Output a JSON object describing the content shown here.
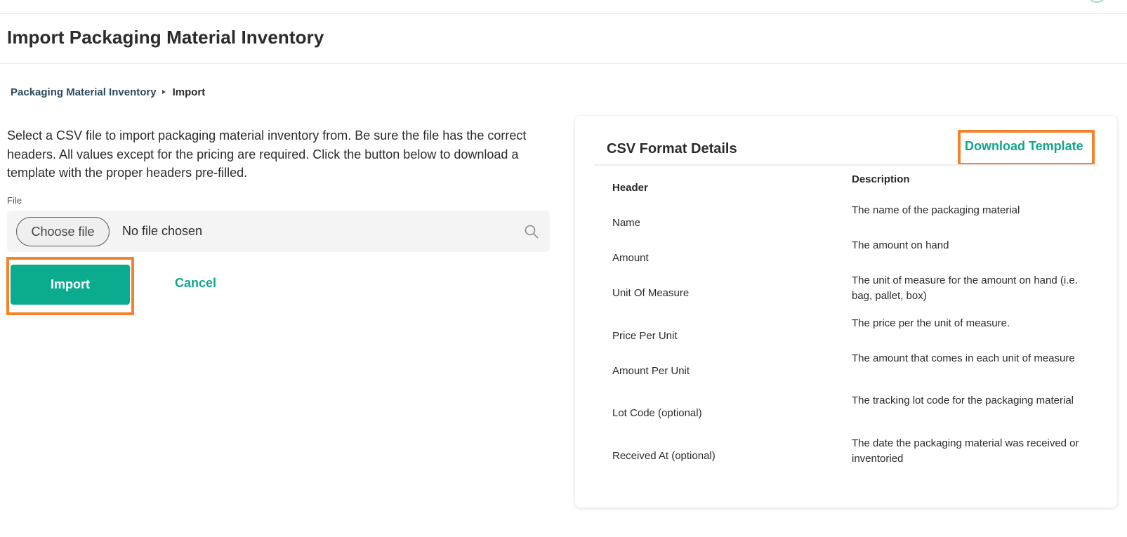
{
  "page": {
    "title": "Import Packaging Material Inventory"
  },
  "breadcrumb": {
    "parent": "Packaging Material Inventory",
    "current": "Import"
  },
  "form": {
    "intro": "Select a CSV file to import packaging material inventory from. Be sure the file has the correct headers. All values except for the pricing are required. Click the button below to download a template with the proper headers pre-filled.",
    "file_label": "File",
    "choose_file_label": "Choose file",
    "no_file_text": "No file chosen",
    "import_label": "Import",
    "cancel_label": "Cancel"
  },
  "csv_card": {
    "title": "CSV Format Details",
    "download_label": "Download Template",
    "columns": [
      "Header",
      "Description"
    ],
    "rows": [
      {
        "header": "Name",
        "description": "The name of the packaging material"
      },
      {
        "header": "Amount",
        "description": "The amount on hand"
      },
      {
        "header": "Unit Of Measure",
        "description": "The unit of measure for the amount on hand (i.e. bag, pallet, box)"
      },
      {
        "header": "Price Per Unit",
        "description": "The price per the unit of measure."
      },
      {
        "header": "Amount Per Unit",
        "description": "The amount that comes in each unit of measure"
      },
      {
        "header": "Lot Code (optional)",
        "description": "The tracking lot code for the packaging material"
      },
      {
        "header": "Received At (optional)",
        "description": "The date the packaging material was received or inventoried"
      }
    ]
  },
  "icons": {
    "search": "search-icon",
    "breadcrumb_separator": "caret-right-icon"
  },
  "colors": {
    "accent": "#0aab8f",
    "link": "#11a68c",
    "highlight": "#f5822a",
    "breadcrumb_link": "#2c4a5e"
  }
}
